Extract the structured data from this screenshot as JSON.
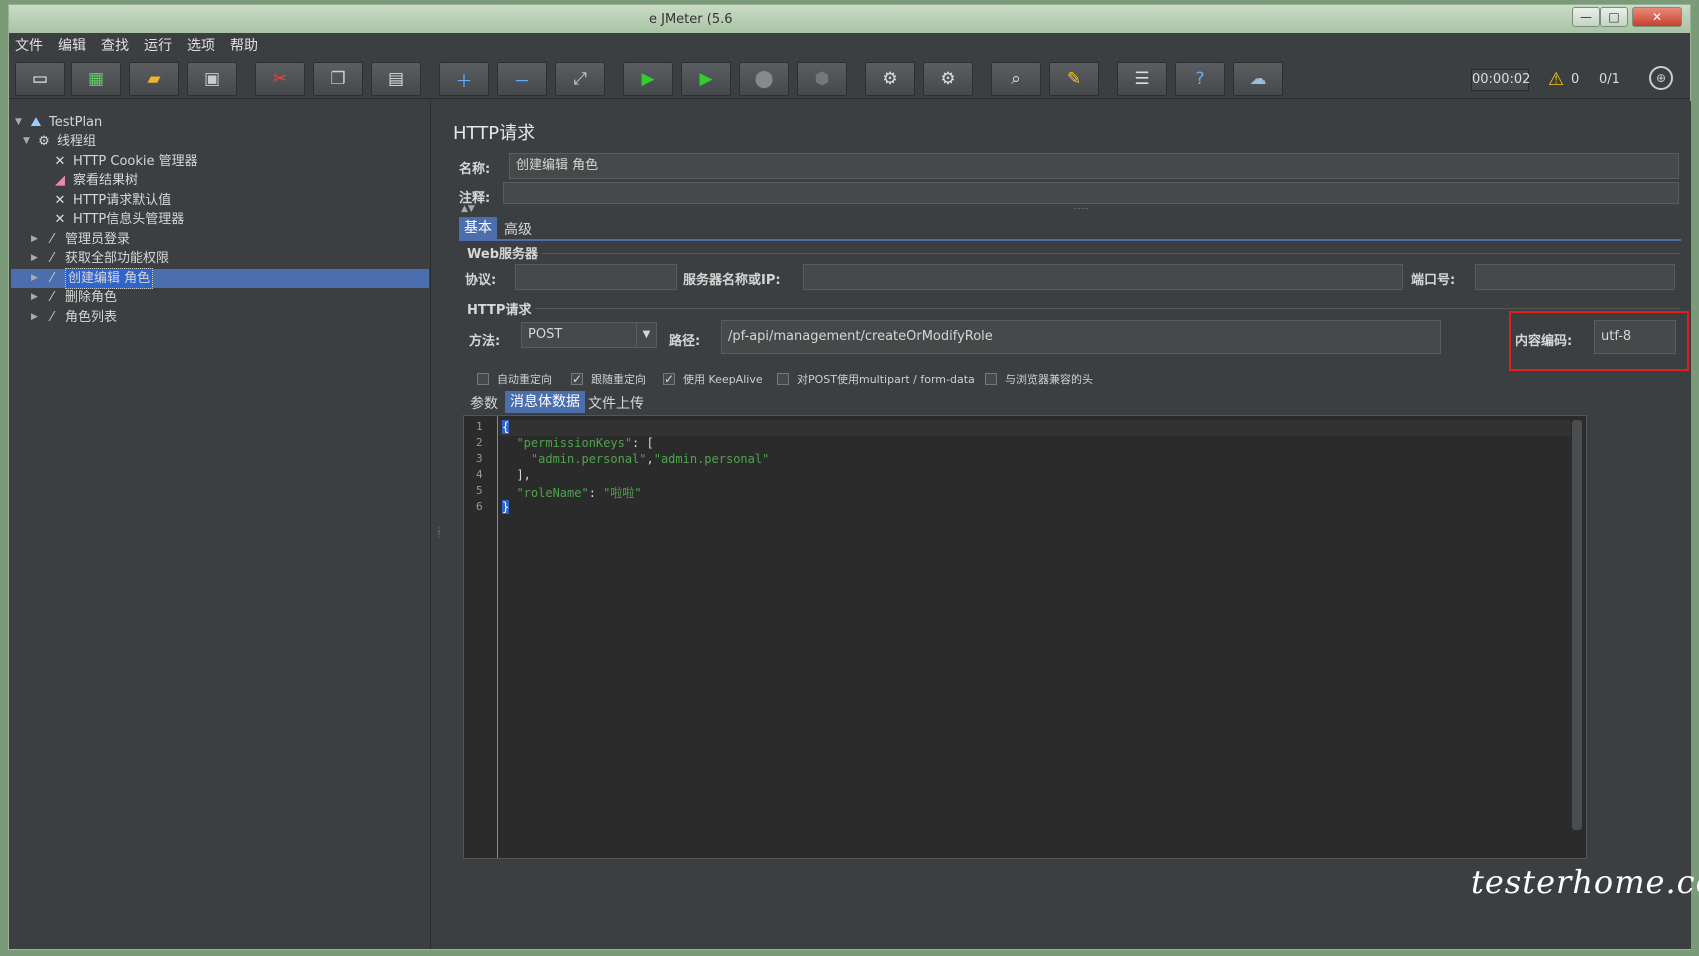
{
  "window": {
    "title": "e JMeter (5.6"
  },
  "menu": [
    "文件",
    "编辑",
    "查找",
    "运行",
    "选项",
    "帮助"
  ],
  "toolbar": {
    "timer": "00:00:02",
    "warnings": "0",
    "threads": "0/1"
  },
  "tree": {
    "items": [
      {
        "label": "TestPlan",
        "icon": "test-plan-icon"
      },
      {
        "label": "线程组",
        "icon": "gear-icon"
      },
      {
        "label": "HTTP Cookie 管理器",
        "icon": "wrench-icon"
      },
      {
        "label": "察看结果树",
        "icon": "chart-icon"
      },
      {
        "label": "HTTP请求默认值",
        "icon": "wrench-icon"
      },
      {
        "label": "HTTP信息头管理器",
        "icon": "wrench-icon"
      },
      {
        "label": "管理员登录",
        "icon": "pipette-icon"
      },
      {
        "label": "获取全部功能权限",
        "icon": "pipette-icon"
      },
      {
        "label": "创建编辑 角色",
        "icon": "pipette-icon"
      },
      {
        "label": "删除角色",
        "icon": "pipette-icon"
      },
      {
        "label": "角色列表",
        "icon": "pipette-icon"
      }
    ]
  },
  "http_request": {
    "title": "HTTP请求",
    "name_label": "名称:",
    "name_value": "创建编辑 角色",
    "comment_label": "注释:",
    "comment_value": "",
    "tabs": [
      "基本",
      "高级"
    ],
    "web_server_group": "Web服务器",
    "protocol_label": "协议:",
    "protocol_value": "",
    "server_label": "服务器名称或IP:",
    "server_value": "",
    "port_label": "端口号:",
    "port_value": "",
    "http_group": "HTTP请求",
    "method_label": "方法:",
    "method_value": "POST",
    "path_label": "路径:",
    "path_value": "/pf-api/management/createOrModifyRole",
    "encoding_label": "内容编码:",
    "encoding_value": "utf-8",
    "checkboxes": [
      {
        "label": "自动重定向",
        "checked": false
      },
      {
        "label": "跟随重定向",
        "checked": true
      },
      {
        "label": "使用 KeepAlive",
        "checked": true
      },
      {
        "label": "对POST使用multipart / form-data",
        "checked": false
      },
      {
        "label": "与浏览器兼容的头",
        "checked": false
      }
    ],
    "body_tabs": [
      "参数",
      "消息体数据",
      "文件上传"
    ],
    "line_numbers": [
      "1",
      "2",
      "3",
      "4",
      "5",
      "6"
    ],
    "code": {
      "l1": "{",
      "l2_key": "\"permissionKeys\"",
      "l2_rest": ": [",
      "l3_a": "\"admin.personal\"",
      "l3_sep": ",",
      "l3_b": "\"admin.personal\"",
      "l4": "],",
      "l5_key": "\"roleName\"",
      "l5_sep": ": ",
      "l5_val": "\"啦啦\"",
      "l6": "}"
    }
  },
  "watermark": "testerhome.com"
}
